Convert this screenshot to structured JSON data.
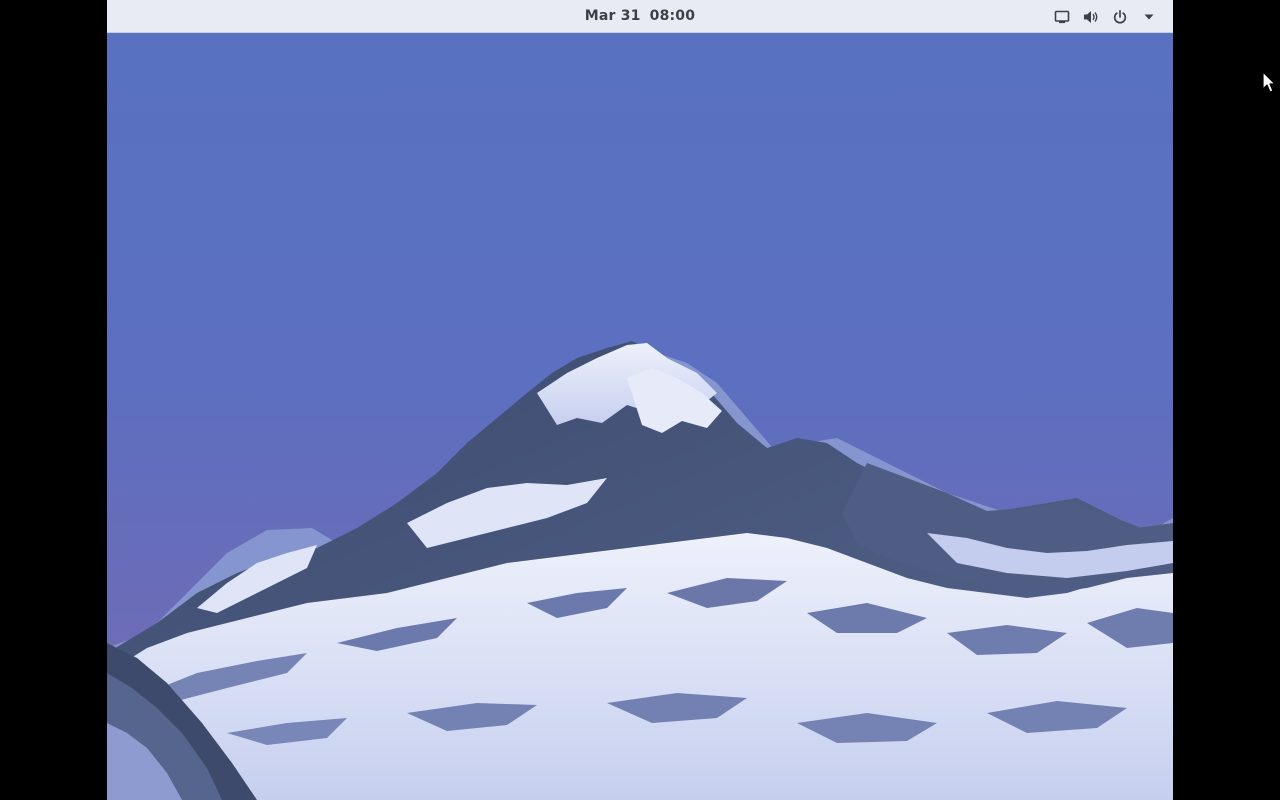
{
  "topbar": {
    "date": "Mar 31",
    "time": "08:00"
  },
  "tray": {
    "items": [
      {
        "icon": "display-icon"
      },
      {
        "icon": "volume-icon"
      },
      {
        "icon": "power-icon"
      },
      {
        "icon": "chevron-down-icon"
      }
    ]
  },
  "wallpaper": {
    "description": "snowy-mountain-peak",
    "sky_color": "#5a6fc0",
    "snow_color": "#eef1fb",
    "rock_color": "#4a5878"
  }
}
